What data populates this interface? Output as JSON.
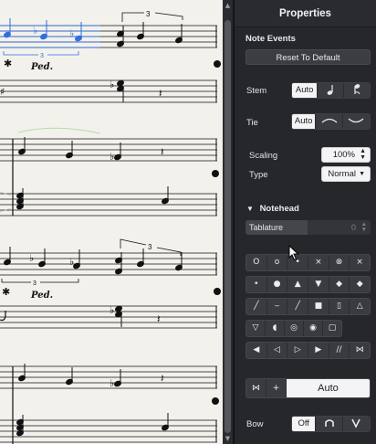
{
  "score": {
    "pedal_marks": [
      "Ped.",
      "Ped."
    ],
    "tuplet_numbers": [
      "3",
      "3",
      "3",
      "3"
    ]
  },
  "panel": {
    "title": "Properties",
    "note_events_section": "Note Events",
    "reset_button": "Reset To Default",
    "stem": {
      "label": "Stem",
      "options": [
        "Auto"
      ],
      "selected": "Auto",
      "icons": [
        "stem-down-icon",
        "stem-up-icon"
      ]
    },
    "tie": {
      "label": "Tie",
      "options": [
        "Auto"
      ],
      "icons": [
        "tie-over-icon",
        "tie-under-icon"
      ]
    },
    "scaling": {
      "label": "Scaling",
      "value": "100%"
    },
    "type": {
      "label": "Type",
      "value": "Normal"
    },
    "notehead_section": "Notehead",
    "tablature": {
      "label": "Tablature",
      "value": "0"
    },
    "notehead_grid": [
      [
        "O",
        "o",
        "•",
        "×",
        "⊗",
        "×"
      ],
      [
        "•",
        "●",
        "▲",
        "▼",
        "◆",
        "◆"
      ],
      [
        "╱",
        "‒",
        "╱",
        "■",
        "▯",
        "△"
      ],
      [
        "▽",
        "◖",
        "◎",
        "◉",
        "▢",
        ""
      ],
      [
        "◀",
        "◁",
        "▷",
        "▶",
        "//",
        "⋈"
      ]
    ],
    "auto_row": {
      "small1": "⋈",
      "small2": "+",
      "main": "Auto"
    },
    "bow": {
      "label": "Bow",
      "options": [
        "Off"
      ],
      "selected": "Off",
      "icons": [
        "bow-up-icon",
        "bow-down-icon"
      ]
    }
  }
}
